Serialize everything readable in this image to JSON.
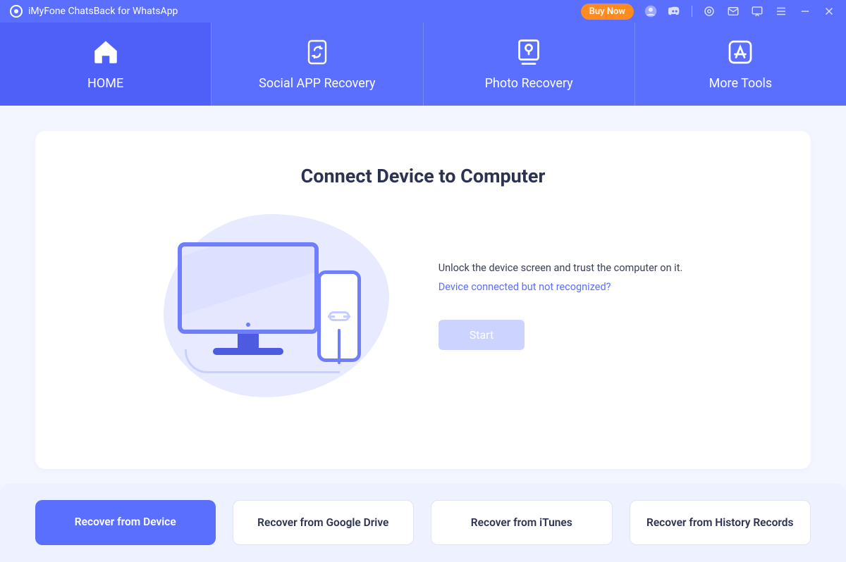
{
  "app": {
    "title": "iMyFone ChatsBack for WhatsApp"
  },
  "topbar": {
    "buy_now": "Buy Now"
  },
  "tabs": {
    "home": "HOME",
    "social": "Social APP Recovery",
    "photo": "Photo Recovery",
    "tools": "More Tools",
    "active": "home"
  },
  "main": {
    "heading": "Connect Device to Computer",
    "instruction": "Unlock the device screen and trust the computer on it.",
    "troubleshoot_link": "Device connected but not recognized?",
    "start_label": "Start"
  },
  "options": {
    "device": "Recover from Device",
    "google_drive": "Recover from Google Drive",
    "itunes": "Recover from iTunes",
    "history": "Recover from History Records",
    "selected": "device"
  },
  "colors": {
    "accent": "#5a6ffd",
    "cta": "#ff8a1f"
  }
}
